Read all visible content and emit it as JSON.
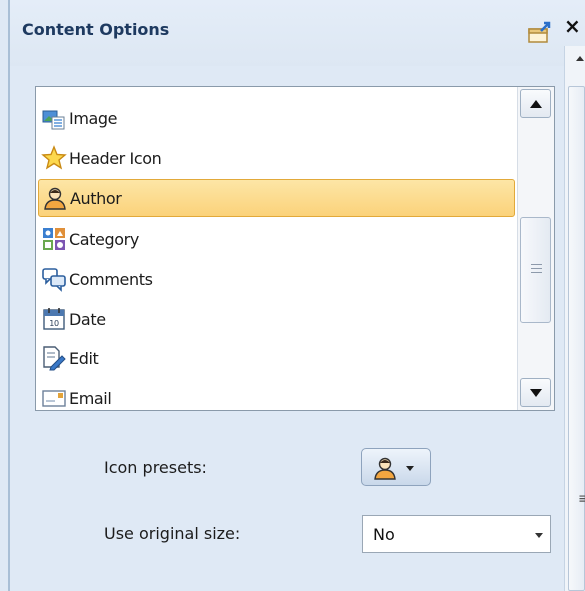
{
  "panel": {
    "title": "Content Options",
    "close_glyph": "×"
  },
  "list": {
    "items": [
      {
        "label": "Image",
        "icon": "image-icon",
        "selected": false
      },
      {
        "label": "Header Icon",
        "icon": "star-icon",
        "selected": false
      },
      {
        "label": "Author",
        "icon": "author-icon",
        "selected": true
      },
      {
        "label": "Category",
        "icon": "category-icon",
        "selected": false
      },
      {
        "label": "Comments",
        "icon": "comments-icon",
        "selected": false
      },
      {
        "label": "Date",
        "icon": "calendar-icon",
        "selected": false
      },
      {
        "label": "Edit",
        "icon": "edit-icon",
        "selected": false
      },
      {
        "label": "Email",
        "icon": "email-icon",
        "selected": false
      }
    ]
  },
  "fields": {
    "icon_presets_label": "Icon presets:",
    "use_original_size_label": "Use original size:",
    "use_original_size_value": "No"
  },
  "colors": {
    "panel_background": "#dfe9f5",
    "title_color": "#1e3a60",
    "selection_fill": "#fbd27a",
    "selection_border": "#e2a93a"
  }
}
